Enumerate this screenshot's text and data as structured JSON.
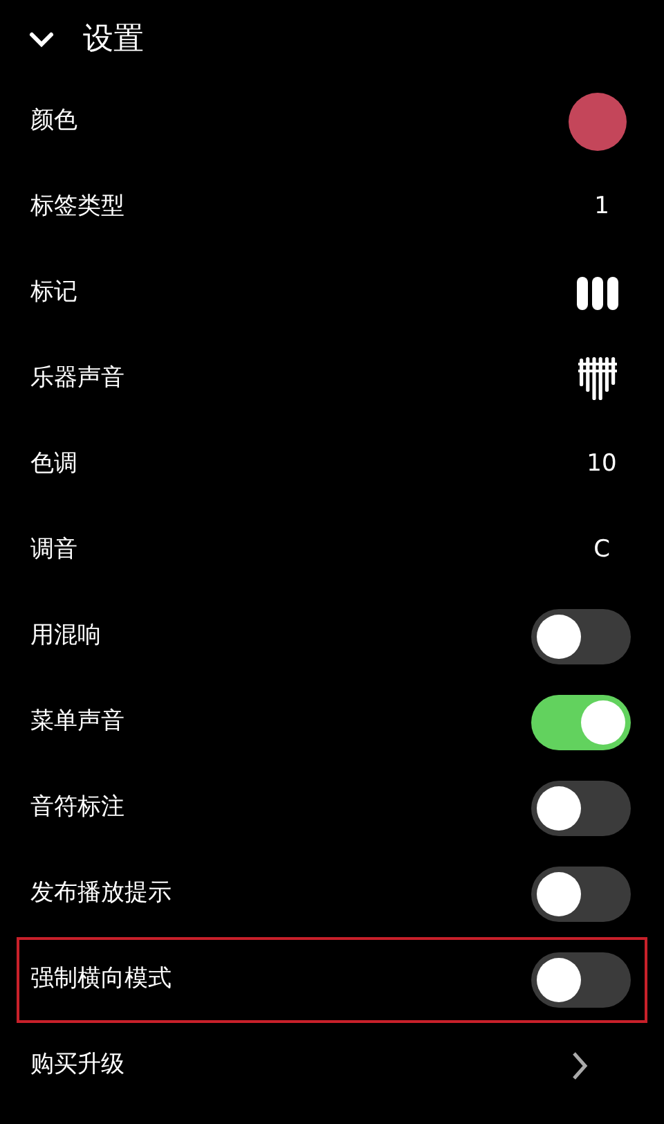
{
  "header": {
    "title": "设置",
    "expanded": true
  },
  "rows": [
    {
      "kind": "color",
      "label": "颜色",
      "color": "#c4465a",
      "highlighted": false
    },
    {
      "kind": "text",
      "label": "标签类型",
      "value": "1",
      "highlighted": false
    },
    {
      "kind": "bars",
      "label": "标记",
      "highlighted": false
    },
    {
      "kind": "pipes",
      "label": "乐器声音",
      "highlighted": false
    },
    {
      "kind": "text",
      "label": "色调",
      "value": "10",
      "highlighted": false
    },
    {
      "kind": "text",
      "label": "调音",
      "value": "C",
      "highlighted": false
    },
    {
      "kind": "toggle",
      "label": "用混响",
      "on": false,
      "highlighted": false
    },
    {
      "kind": "toggle",
      "label": "菜单声音",
      "on": true,
      "highlighted": false
    },
    {
      "kind": "toggle",
      "label": "音符标注",
      "on": false,
      "highlighted": false
    },
    {
      "kind": "toggle",
      "label": "发布播放提示",
      "on": false,
      "highlighted": false
    },
    {
      "kind": "toggle",
      "label": "强制横向模式",
      "on": false,
      "highlighted": true
    },
    {
      "kind": "link",
      "label": "购买升级",
      "highlighted": false
    }
  ]
}
